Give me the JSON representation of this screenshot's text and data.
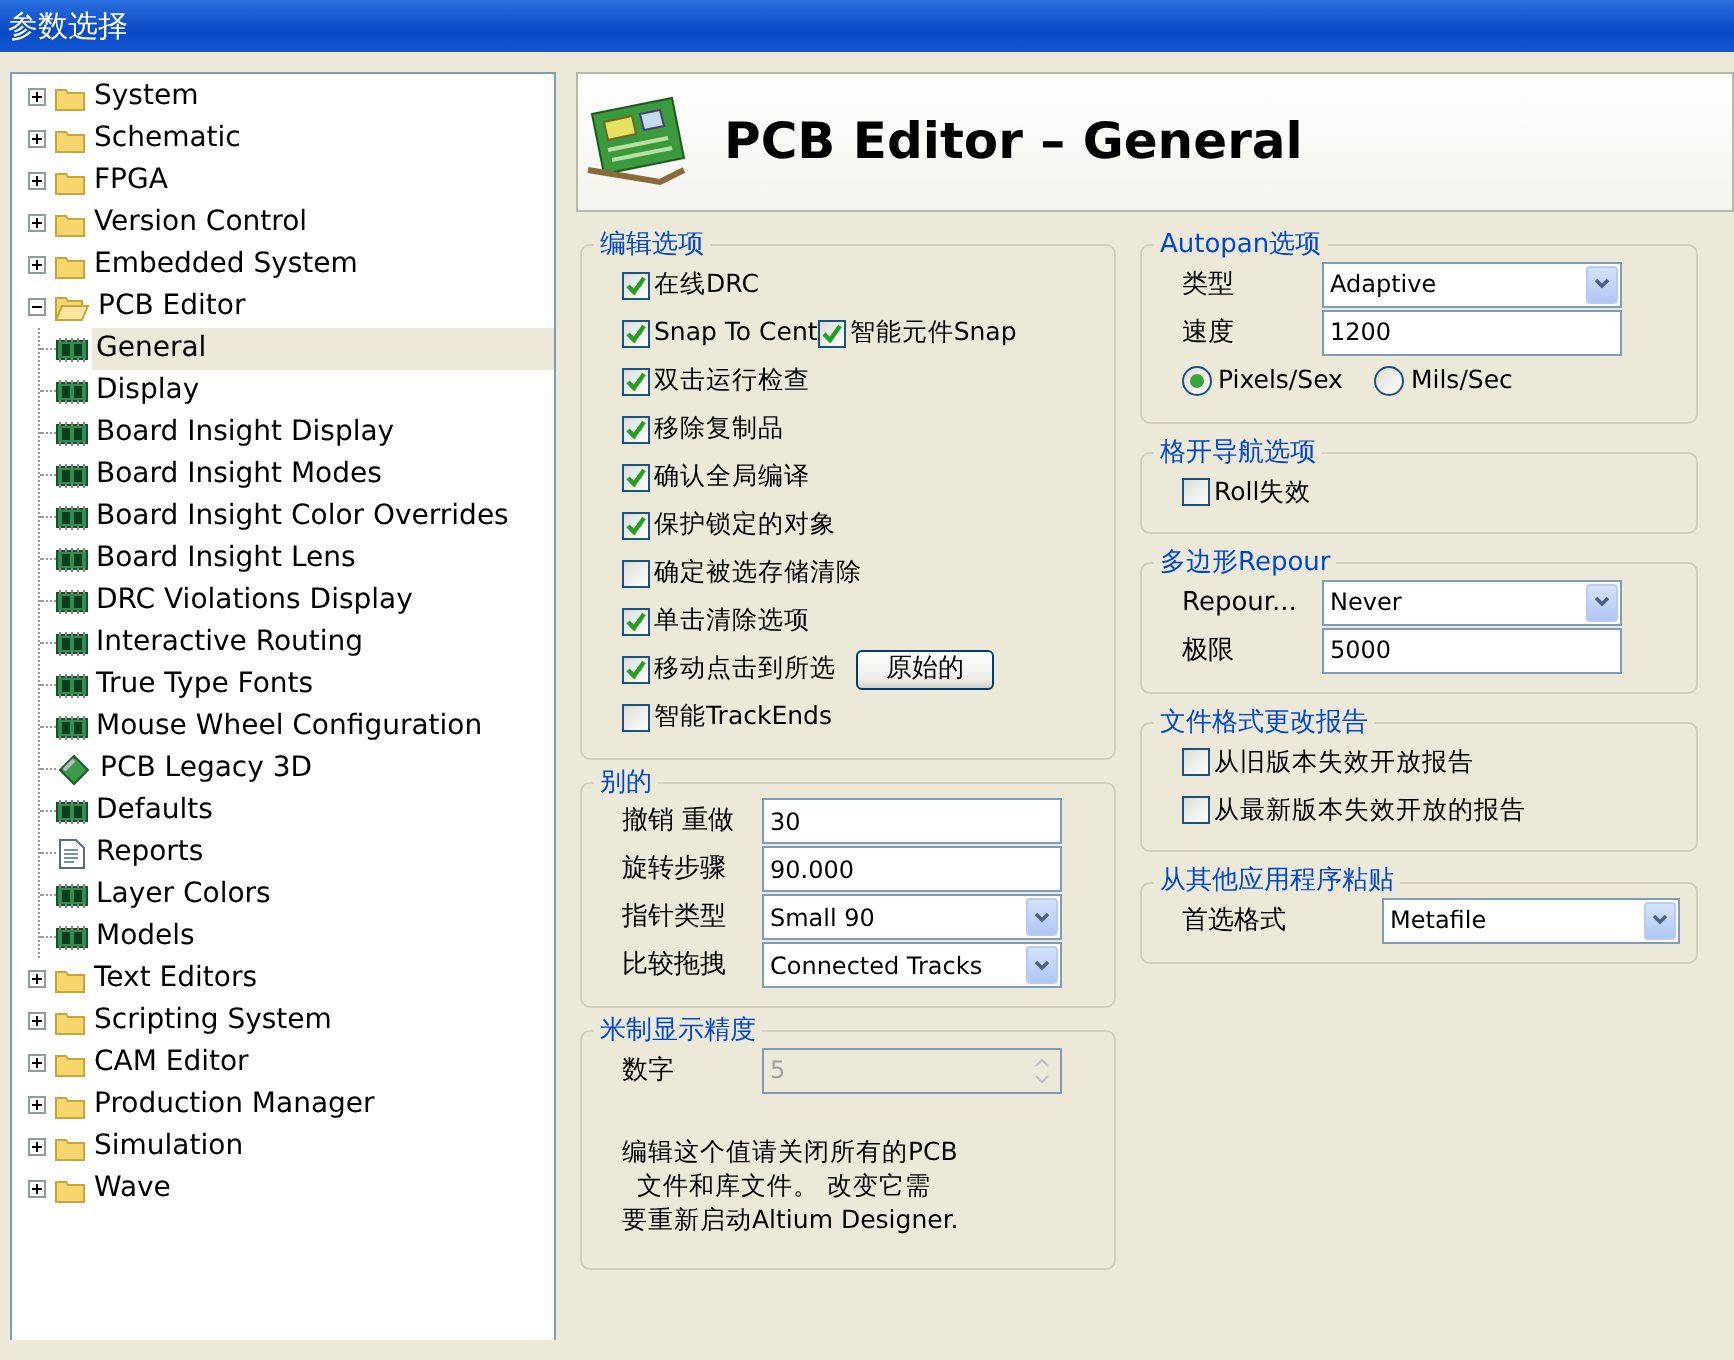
{
  "window": {
    "title": "参数选择"
  },
  "tree": [
    {
      "label": "System",
      "kind": "folder",
      "expanded": false,
      "selected": false
    },
    {
      "label": "Schematic",
      "kind": "folder",
      "expanded": false,
      "selected": false
    },
    {
      "label": "FPGA",
      "kind": "folder",
      "expanded": false,
      "selected": false
    },
    {
      "label": "Version Control",
      "kind": "folder",
      "expanded": false,
      "selected": false
    },
    {
      "label": "Embedded System",
      "kind": "folder",
      "expanded": false,
      "selected": false
    },
    {
      "label": "PCB Editor",
      "kind": "folder",
      "expanded": true,
      "selected": false,
      "children": [
        {
          "label": "General",
          "kind": "page",
          "selected": true
        },
        {
          "label": "Display",
          "kind": "page",
          "selected": false
        },
        {
          "label": "Board Insight Display",
          "kind": "page",
          "selected": false
        },
        {
          "label": "Board Insight Modes",
          "kind": "page",
          "selected": false
        },
        {
          "label": "Board Insight Color Overrides",
          "kind": "page",
          "selected": false
        },
        {
          "label": "Board Insight Lens",
          "kind": "page",
          "selected": false
        },
        {
          "label": "DRC Violations Display",
          "kind": "page",
          "selected": false
        },
        {
          "label": "Interactive Routing",
          "kind": "page",
          "selected": false
        },
        {
          "label": "True Type Fonts",
          "kind": "page",
          "selected": false
        },
        {
          "label": "Mouse Wheel Configuration",
          "kind": "page",
          "selected": false
        },
        {
          "label": "PCB Legacy 3D",
          "kind": "model",
          "selected": false
        },
        {
          "label": "Defaults",
          "kind": "page",
          "selected": false
        },
        {
          "label": "Reports",
          "kind": "document",
          "selected": false
        },
        {
          "label": "Layer Colors",
          "kind": "page",
          "selected": false
        },
        {
          "label": "Models",
          "kind": "page",
          "selected": false
        }
      ]
    },
    {
      "label": "Text Editors",
      "kind": "folder",
      "expanded": false,
      "selected": false
    },
    {
      "label": "Scripting System",
      "kind": "folder",
      "expanded": false,
      "selected": false
    },
    {
      "label": "CAM Editor",
      "kind": "folder",
      "expanded": false,
      "selected": false
    },
    {
      "label": "Production Manager",
      "kind": "folder",
      "expanded": false,
      "selected": false
    },
    {
      "label": "Simulation",
      "kind": "folder",
      "expanded": false,
      "selected": false
    },
    {
      "label": "Wave",
      "kind": "folder",
      "expanded": false,
      "selected": false
    }
  ],
  "header": {
    "title": "PCB Editor – General"
  },
  "left_groups": [
    {
      "title": "编辑选项",
      "rows": [
        [
          {
            "kind": "checkbox",
            "label": "在线DRC",
            "checked": true
          }
        ],
        [
          {
            "kind": "checkbox",
            "label": "Snap To Cent",
            "checked": true
          },
          {
            "kind": "checkbox",
            "label": "智能元件Snap",
            "checked": true
          }
        ],
        [
          {
            "kind": "checkbox",
            "label": "双击运行检查",
            "checked": true
          }
        ],
        [
          {
            "kind": "checkbox",
            "label": "移除复制品",
            "checked": true
          }
        ],
        [
          {
            "kind": "checkbox",
            "label": "确认全局编译",
            "checked": true
          }
        ],
        [
          {
            "kind": "checkbox",
            "label": "保护锁定的对象",
            "checked": true
          }
        ],
        [
          {
            "kind": "checkbox",
            "label": "确定被选存储清除",
            "checked": false
          }
        ],
        [
          {
            "kind": "checkbox",
            "label": "单击清除选项",
            "checked": true
          }
        ],
        [
          {
            "kind": "checkbox",
            "label": "移动点击到所选",
            "checked": true
          },
          {
            "kind": "button",
            "label": "原始的"
          }
        ],
        [
          {
            "kind": "checkbox",
            "label": "智能TrackEnds",
            "checked": false
          }
        ]
      ]
    },
    {
      "title": "别的",
      "rows": [
        [
          {
            "kind": "text",
            "label": "撤销 重做",
            "value": "30"
          }
        ],
        [
          {
            "kind": "text",
            "label": "旋转步骤",
            "value": "90.000"
          }
        ],
        [
          {
            "kind": "select",
            "label": "指针类型",
            "value": "Small 90"
          }
        ],
        [
          {
            "kind": "select",
            "label": "比较拖拽",
            "value": "Connected Tracks"
          }
        ]
      ]
    },
    {
      "title": "米制显示精度",
      "rows": [
        [
          {
            "kind": "spin",
            "label": "数字",
            "value": "5",
            "disabled": true
          }
        ],
        [
          {
            "kind": "note",
            "lines": [
              "编辑这个值请关闭所有的PCB",
              "文件和库文件。 改变它需",
              "要重新启动Altium Designer."
            ]
          }
        ]
      ]
    }
  ],
  "right_groups": [
    {
      "title": "Autopan选项",
      "rows": [
        [
          {
            "kind": "select",
            "label": "类型",
            "value": "Adaptive"
          }
        ],
        [
          {
            "kind": "text",
            "label": "速度",
            "value": "1200"
          }
        ],
        [
          {
            "kind": "radio",
            "label": "Pixels/Sex",
            "selected": true
          },
          {
            "kind": "radio",
            "label": "Mils/Sec",
            "selected": false
          }
        ]
      ]
    },
    {
      "title": "格开导航选项",
      "rows": [
        [
          {
            "kind": "checkbox",
            "label": "Roll失效",
            "checked": false
          }
        ]
      ]
    },
    {
      "title": "多边形Repour",
      "rows": [
        [
          {
            "kind": "select",
            "label": "Repour...",
            "value": "Never"
          }
        ],
        [
          {
            "kind": "text",
            "label": "极限",
            "value": "5000"
          }
        ]
      ]
    },
    {
      "title": "文件格式更改报告",
      "rows": [
        [
          {
            "kind": "checkbox",
            "label": "从旧版本失效开放报告",
            "checked": false
          }
        ],
        [
          {
            "kind": "checkbox",
            "label": "从最新版本失效开放的报告",
            "checked": false
          }
        ]
      ]
    },
    {
      "title": "从其他应用程序粘贴",
      "rows": [
        [
          {
            "kind": "select",
            "label": "首选格式",
            "value": "Metafile",
            "wide_label": true
          }
        ]
      ]
    }
  ]
}
